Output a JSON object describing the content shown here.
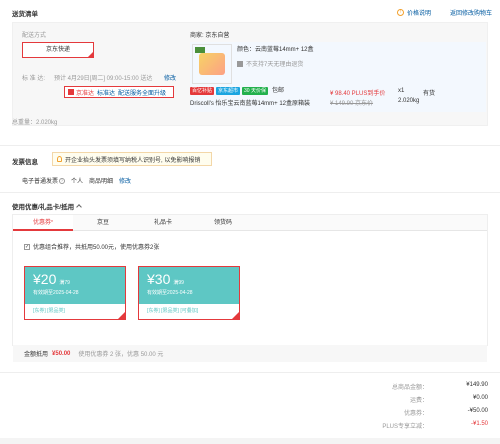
{
  "header": {
    "title": "送货清单",
    "price_note": "价格说明",
    "back_cart": "返回修改购物车"
  },
  "delivery": {
    "method_label": "配送方式",
    "method_value": "京东快递",
    "std_label": "标 准 达:",
    "std_time": "预计 4月29日[周二] 09:00-15:00 送达",
    "std_modify": "修改",
    "upgrade_tag": "京准达",
    "upgrade_text1": "标准达",
    "upgrade_text2": "配送服务全面升级"
  },
  "shop": {
    "name": "商家: 京东自营",
    "tag1": "百亿补贴",
    "tag2": "京东超市",
    "tag3": "30 天价保",
    "tag4": "包邮",
    "product_name": "Driscoll's 怡乐宝云南蓝莓14mm+ 12盒原箱装",
    "color": "颜色：云南蓝莓14mm+ 12盒",
    "no_return": "不支持7天无理由退货",
    "price": "¥ 98.40 PLUS到手价",
    "orig_price": "¥ 149.90 京东价",
    "qty": "x1",
    "stock": "有货",
    "weight": "2.020kg"
  },
  "total_weight": "总重量：2.020kg",
  "invoice": {
    "title": "发票信息",
    "notice": "开企业抬头发票须填写纳税人识别号, 以免影响报销",
    "type": "电子普通发票",
    "personal": "个人",
    "detail": "商品明细",
    "modify": "修改"
  },
  "coupons": {
    "title": "使用优惠/礼品卡/抵用",
    "tabs": [
      "优惠券",
      "京豆",
      "礼品卡",
      "领货码"
    ],
    "option": "优惠组合推荐，共抵用50.00元，使用优惠券2张",
    "items": [
      {
        "amount": "¥20",
        "cond": "满79",
        "expire": "有效期至2025-04-28",
        "tags": "[东券]  [限品类]"
      },
      {
        "amount": "¥30",
        "cond": "满99",
        "expire": "有效期至2025-04-28",
        "tags": "[东券]  [限品类]  [可叠加]"
      }
    ],
    "summary_label": "金额抵用",
    "summary_amount": "¥50.00",
    "summary_text": "使用优惠券 2 张，优惠 50.00 元"
  },
  "summary": {
    "rows": [
      {
        "label": "总商品金额：",
        "value": "¥149.90"
      },
      {
        "label": "运费：",
        "value": "¥0.00"
      },
      {
        "label": "优惠券：",
        "value": "-¥50.00"
      },
      {
        "label": "PLUS专享立减：",
        "value": "-¥1.50"
      }
    ]
  },
  "colors": {
    "accent": "#e4393c",
    "teal": "#5ec7c4",
    "link": "#005aa0"
  }
}
